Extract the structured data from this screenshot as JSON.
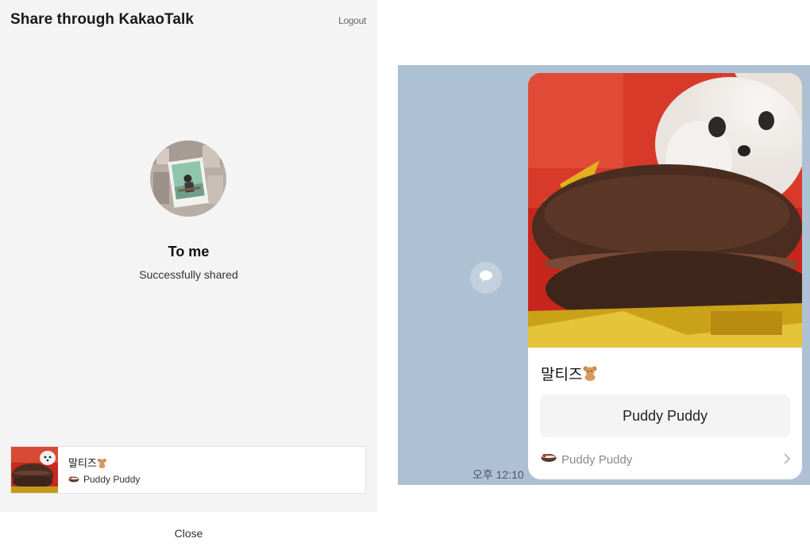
{
  "share_panel": {
    "title": "Share through KakaoTalk",
    "logout_label": "Logout",
    "recipient": {
      "name": "To me",
      "status": "Successfully shared"
    },
    "preview": {
      "title": "말티즈",
      "source": "Puddy Puddy"
    },
    "close_label": "Close"
  },
  "chat_preview": {
    "message_time": "오후 12:10",
    "card": {
      "title": "말티즈",
      "button_label": "Puddy Puddy",
      "source": "Puddy Puddy"
    }
  },
  "icons": {
    "share": "speech-bubble-icon",
    "title_emoji": "teddy-bear-icon",
    "source_logo": "puddy-logo-icon",
    "footer_arrow": "chevron-right-icon"
  },
  "colors": {
    "panel_bg": "#f4f4f4",
    "chat_bg": "#aec1d4",
    "card_button_bg": "#f4f4f4"
  }
}
